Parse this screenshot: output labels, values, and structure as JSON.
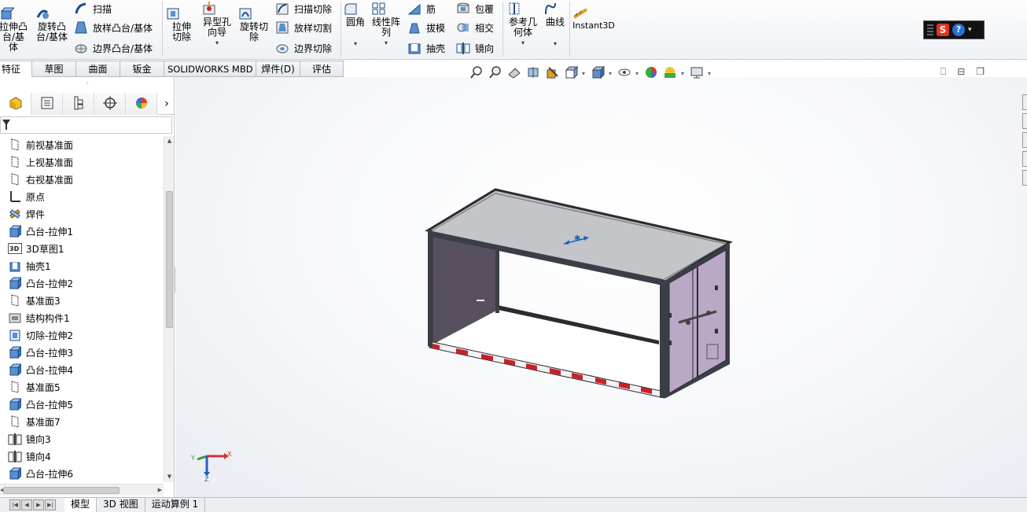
{
  "ribbon": {
    "extrude_boss": "拉伸凸台/基体",
    "revolve_boss": "旋转凸台/基体",
    "sweep": "扫描",
    "loft_boss": "放样凸台/基体",
    "boundary_boss": "边界凸台/基体",
    "extrude_cut": "拉伸切除",
    "hole_wizard": "异型孔向导",
    "revolve_cut": "旋转切除",
    "sweep_cut": "扫描切除",
    "loft_cut": "放样切割",
    "boundary_cut": "边界切除",
    "fillet": "圆角",
    "linear_pattern": "线性阵列",
    "rib": "筋",
    "draft": "拔模",
    "shell": "抽壳",
    "wrap": "包覆",
    "intersect": "相交",
    "mirror": "镜向",
    "ref_geometry": "参考几何体",
    "curves": "曲线",
    "instant3d": "Instant3D"
  },
  "command_tabs": [
    "特征",
    "草图",
    "曲面",
    "钣金",
    "SOLIDWORKS MBD",
    "焊件(D)",
    "评估"
  ],
  "ime": {
    "logo": "S",
    "help": "?",
    "arrow": "▾"
  },
  "window_controls": [
    "⎕",
    "⊟",
    "❐"
  ],
  "panel": {
    "next_arrow": "›",
    "grip": "◦"
  },
  "tree": [
    {
      "label": "前视基准面",
      "icon": "plane-icon"
    },
    {
      "label": "上视基准面",
      "icon": "plane-icon"
    },
    {
      "label": "右视基准面",
      "icon": "plane-icon"
    },
    {
      "label": "原点",
      "icon": "origin-icon"
    },
    {
      "label": "焊件",
      "icon": "weldment-icon"
    },
    {
      "label": "凸台-拉伸1",
      "icon": "boss-extrude-icon"
    },
    {
      "label": "3D草图1",
      "icon": "3d-sketch-icon"
    },
    {
      "label": "抽壳1",
      "icon": "shell-icon"
    },
    {
      "label": "凸台-拉伸2",
      "icon": "boss-extrude-icon"
    },
    {
      "label": "基准面3",
      "icon": "plane-icon"
    },
    {
      "label": "结构构件1",
      "icon": "structural-member-icon"
    },
    {
      "label": "切除-拉伸2",
      "icon": "cut-extrude-icon"
    },
    {
      "label": "凸台-拉伸3",
      "icon": "boss-extrude-icon"
    },
    {
      "label": "凸台-拉伸4",
      "icon": "boss-extrude-icon"
    },
    {
      "label": "基准面5",
      "icon": "plane-icon"
    },
    {
      "label": "凸台-拉伸5",
      "icon": "boss-extrude-icon"
    },
    {
      "label": "基准面7",
      "icon": "plane-icon"
    },
    {
      "label": "镜向3",
      "icon": "mirror-icon"
    },
    {
      "label": "镜向4",
      "icon": "mirror-icon"
    },
    {
      "label": "凸台-拉伸6",
      "icon": "boss-extrude-icon"
    }
  ],
  "triad": {
    "x": "X",
    "y": "Y",
    "z": "Z"
  },
  "bottom_tabs": [
    "模型",
    "3D 视图",
    "运动算例 1"
  ],
  "colors": {
    "accent_blue": "#1f5fbf",
    "container_frame": "#3a3f47",
    "container_roof": "#bcbec2",
    "door": "#b9a8c6",
    "stripe_red": "#c8202a"
  }
}
